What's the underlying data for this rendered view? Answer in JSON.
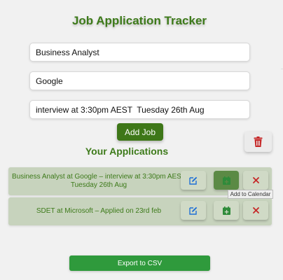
{
  "app": {
    "title": "Job Application Tracker"
  },
  "form": {
    "job_title": "Business Analyst",
    "company": "Google",
    "status": "interview at 3:30pm AEST  Tuesday 26th Aug",
    "add_label": "Add Job"
  },
  "list": {
    "heading": "Your Applications",
    "items": [
      {
        "text": "Business Analyst at Google – interview at 3:30pm AEST Tuesday 26th Aug"
      },
      {
        "text": "SDET at Microsoft – Applied on 23rd feb"
      }
    ]
  },
  "tooltip": "Add to Calendar",
  "export_label": "Export to CSV",
  "icons": {
    "clear": "trash-icon",
    "edit": "edit-icon",
    "calendar": "calendar-add-icon",
    "delete": "close-icon"
  },
  "colors": {
    "accent": "#3d7a1a",
    "button": "#3e7718",
    "row_bg": "#c7d3bd",
    "danger": "#c62828",
    "edit_blue": "#1e6fd6",
    "calendar_green": "#2e8b3a",
    "export": "#2f9a3c"
  }
}
